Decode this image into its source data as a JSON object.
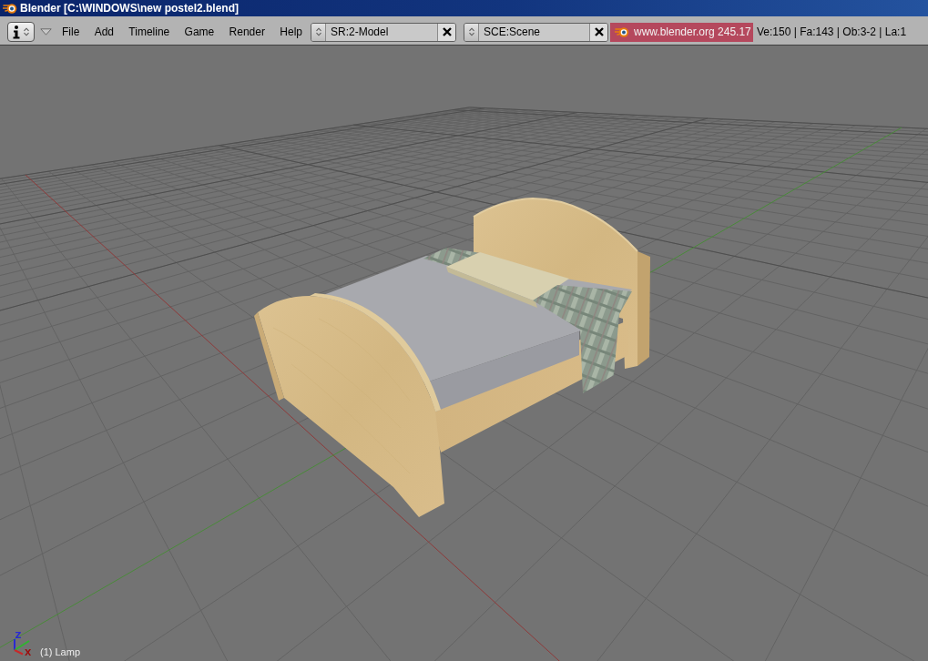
{
  "window": {
    "title": "Blender [C:\\WINDOWS\\new postel2.blend]"
  },
  "header": {
    "menus": [
      "File",
      "Add",
      "Timeline",
      "Game",
      "Render",
      "Help"
    ],
    "screen_selector": {
      "value": "SR:2-Model"
    },
    "scene_selector": {
      "value": "SCE:Scene"
    },
    "version": "www.blender.org 245.17",
    "stats": "Ve:150 | Fa:143 | Ob:3-2 | La:1"
  },
  "viewport": {
    "axis_gizmo": [
      {
        "label": "Z",
        "color": "#2a2ad0"
      },
      {
        "label": "X",
        "color": "#9a1010"
      }
    ],
    "status": "(1) Lamp"
  }
}
